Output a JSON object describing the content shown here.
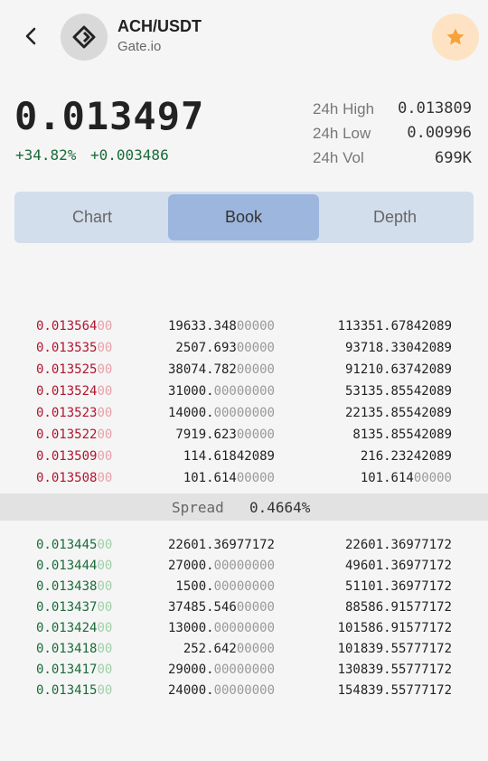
{
  "header": {
    "back_icon": "back-arrow-icon",
    "coin_icon": "gate-logo-icon",
    "pair": "ACH/USDT",
    "exchange": "Gate.io",
    "favorite_icon": "star-icon",
    "favorite_color": "#f5a33a"
  },
  "ticker": {
    "price": "0.013497",
    "change_percent": "+34.82%",
    "change_abs": "+0.003486",
    "high_label": "24h High",
    "high_value": "0.013809",
    "low_label": "24h Low",
    "low_value": "0.00996",
    "vol_label": "24h Vol",
    "vol_value": "699K"
  },
  "tabs": [
    {
      "label": "Chart",
      "active": false
    },
    {
      "label": "Book",
      "active": true
    },
    {
      "label": "Depth",
      "active": false
    }
  ],
  "asks": [
    {
      "price": "0.013564",
      "price_pad": "00",
      "amount": "19633.348",
      "amount_pad": "00000",
      "total": "113351.67842089",
      "total_pad": ""
    },
    {
      "price": "0.013535",
      "price_pad": "00",
      "amount": "2507.693",
      "amount_pad": "00000",
      "total": "93718.33042089",
      "total_pad": ""
    },
    {
      "price": "0.013525",
      "price_pad": "00",
      "amount": "38074.782",
      "amount_pad": "00000",
      "total": "91210.63742089",
      "total_pad": ""
    },
    {
      "price": "0.013524",
      "price_pad": "00",
      "amount": "31000.",
      "amount_pad": "00000000",
      "total": "53135.85542089",
      "total_pad": ""
    },
    {
      "price": "0.013523",
      "price_pad": "00",
      "amount": "14000.",
      "amount_pad": "00000000",
      "total": "22135.85542089",
      "total_pad": ""
    },
    {
      "price": "0.013522",
      "price_pad": "00",
      "amount": "7919.623",
      "amount_pad": "00000",
      "total": "8135.85542089",
      "total_pad": ""
    },
    {
      "price": "0.013509",
      "price_pad": "00",
      "amount": "114.61842089",
      "amount_pad": "",
      "total": "216.23242089",
      "total_pad": ""
    },
    {
      "price": "0.013508",
      "price_pad": "00",
      "amount": "101.614",
      "amount_pad": "00000",
      "total": "101.614",
      "total_pad": "00000"
    }
  ],
  "spread": {
    "label": "Spread",
    "value": "0.4664%"
  },
  "bids": [
    {
      "price": "0.013445",
      "price_pad": "00",
      "amount": "22601.36977172",
      "amount_pad": "",
      "total": "22601.36977172",
      "total_pad": ""
    },
    {
      "price": "0.013444",
      "price_pad": "00",
      "amount": "27000.",
      "amount_pad": "00000000",
      "total": "49601.36977172",
      "total_pad": ""
    },
    {
      "price": "0.013438",
      "price_pad": "00",
      "amount": "1500.",
      "amount_pad": "00000000",
      "total": "51101.36977172",
      "total_pad": ""
    },
    {
      "price": "0.013437",
      "price_pad": "00",
      "amount": "37485.546",
      "amount_pad": "00000",
      "total": "88586.91577172",
      "total_pad": ""
    },
    {
      "price": "0.013424",
      "price_pad": "00",
      "amount": "13000.",
      "amount_pad": "00000000",
      "total": "101586.91577172",
      "total_pad": ""
    },
    {
      "price": "0.013418",
      "price_pad": "00",
      "amount": "252.642",
      "amount_pad": "00000",
      "total": "101839.55777172",
      "total_pad": ""
    },
    {
      "price": "0.013417",
      "price_pad": "00",
      "amount": "29000.",
      "amount_pad": "00000000",
      "total": "130839.55777172",
      "total_pad": ""
    },
    {
      "price": "0.013415",
      "price_pad": "00",
      "amount": "24000.",
      "amount_pad": "00000000",
      "total": "154839.55777172",
      "total_pad": ""
    }
  ],
  "colors": {
    "ask": "#b01530",
    "bid": "#1b6b3a",
    "active_tab": "#9cb6de",
    "tab_bar": "#d3deec"
  }
}
